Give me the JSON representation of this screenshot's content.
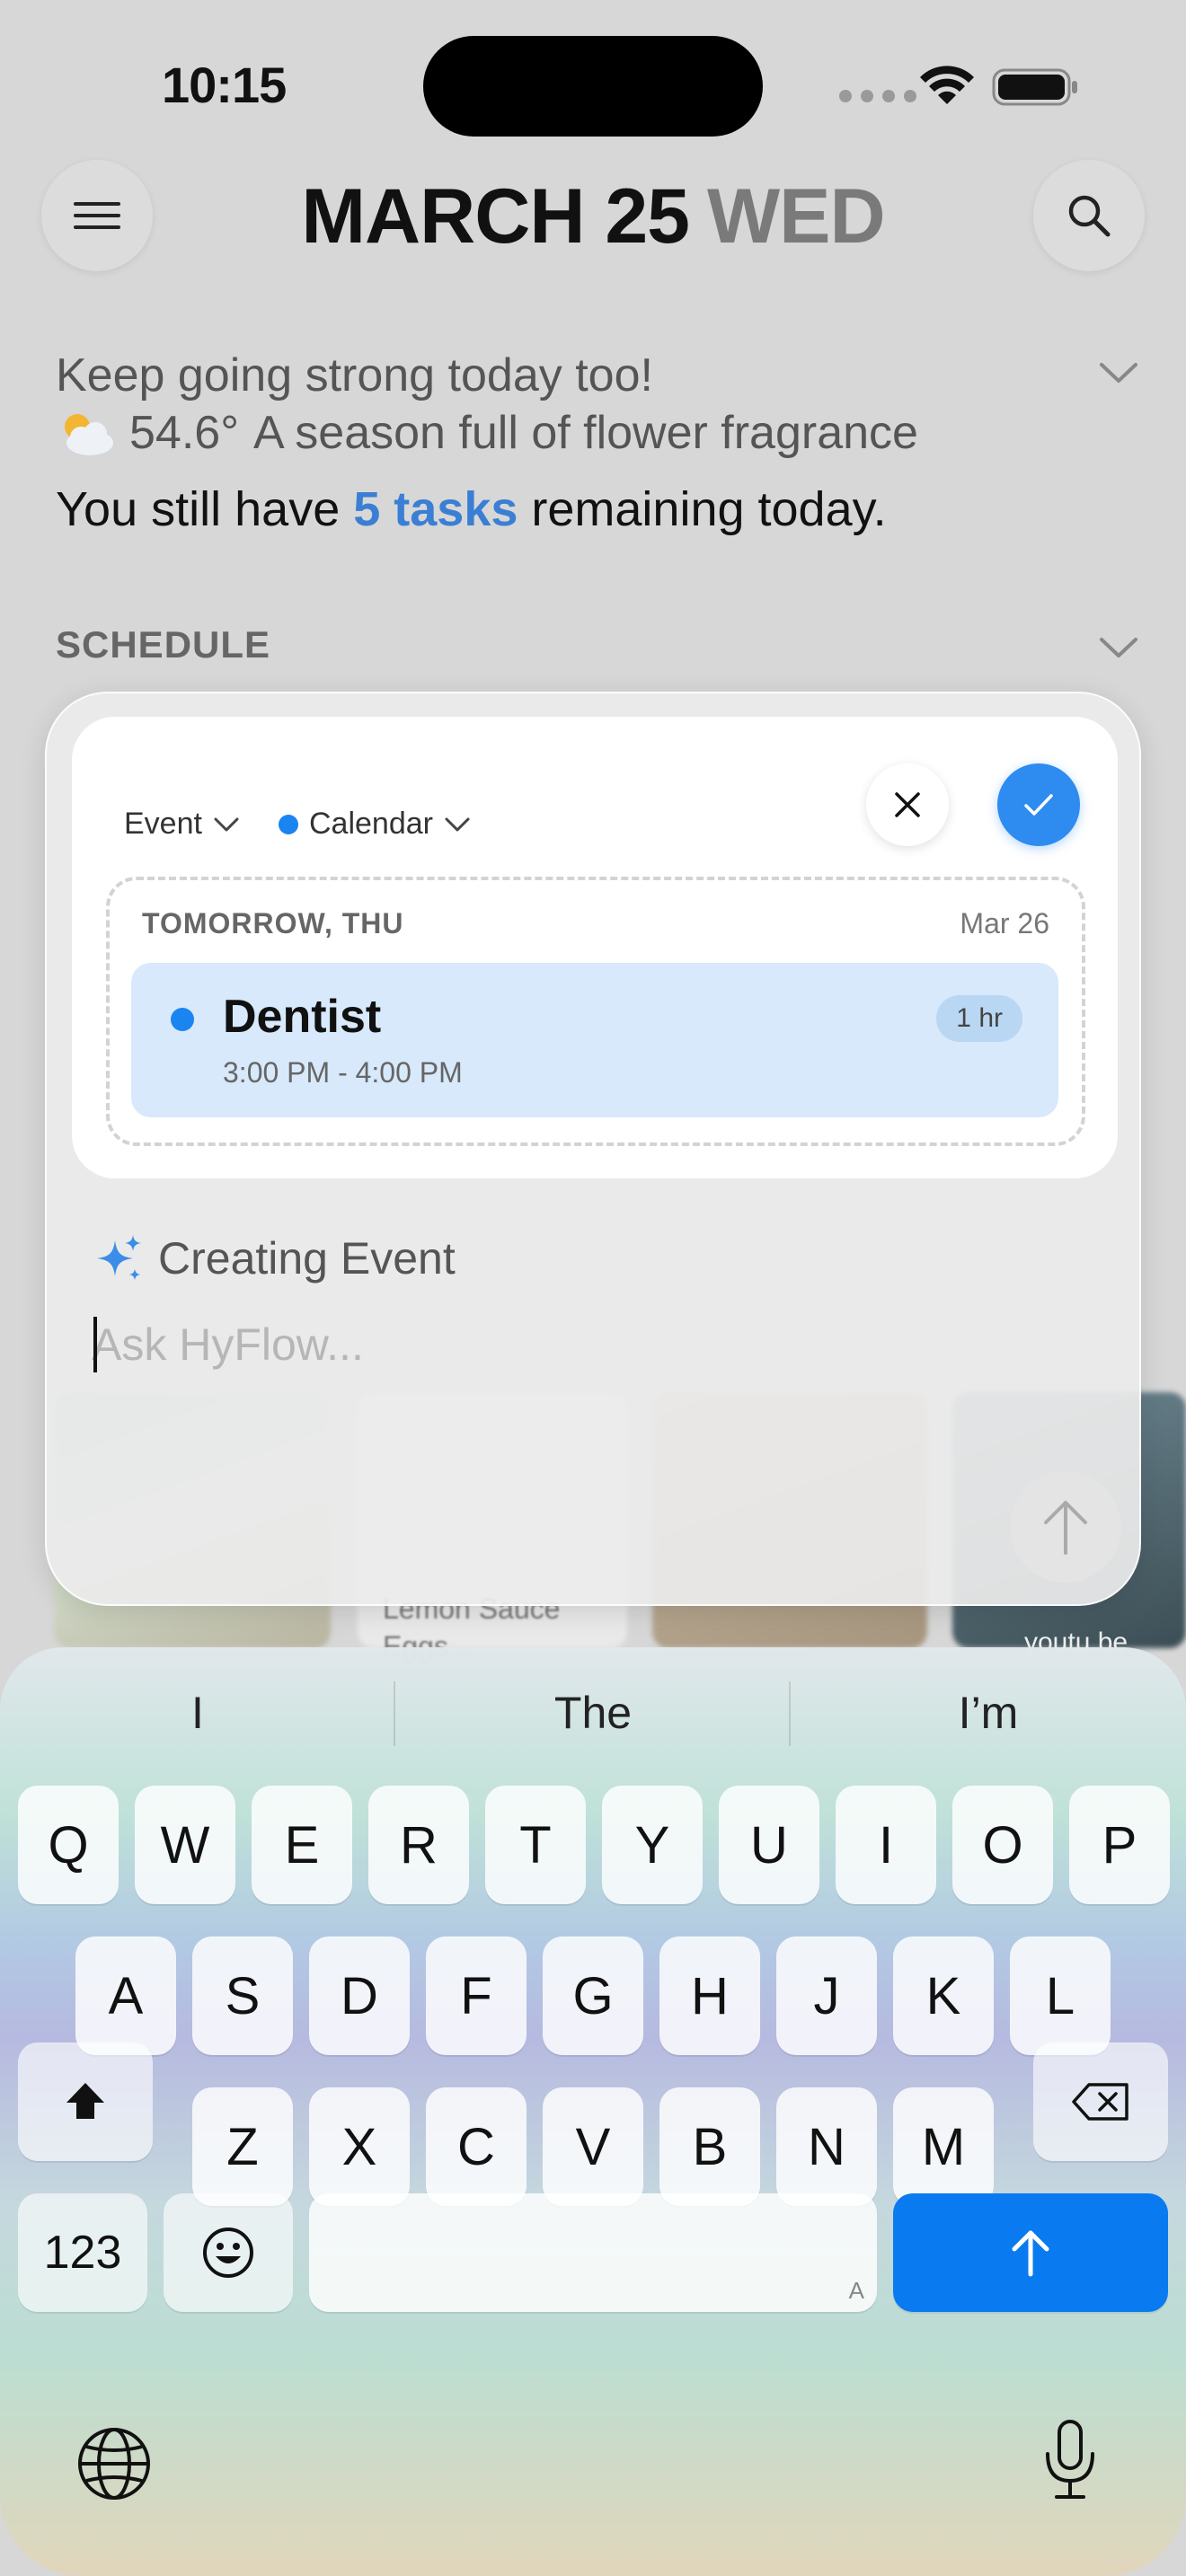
{
  "status": {
    "time": "10:15"
  },
  "header": {
    "date": "MARCH 25",
    "day": "WED"
  },
  "summary": {
    "greeting": "Keep going strong today too!",
    "weather_icon": "partly-cloudy-icon",
    "temperature": "54.6°",
    "weather_text": "A season full of flower fragrance",
    "tasks_prefix": "You still have ",
    "tasks_count": "5 tasks",
    "tasks_suffix": " remaining today."
  },
  "schedule": {
    "label": "SCHEDULE"
  },
  "background_cards": {
    "card_text": "Lemon Sauce\nEggs...",
    "card_text_right": "youtu.be"
  },
  "sheet": {
    "type_dropdown": "Event",
    "calendar_dropdown": "Calendar",
    "calendar_color": "#1a84f0",
    "preview": {
      "day_label": "TOMORROW, THU",
      "date_label": "Mar 26",
      "event_title": "Dentist",
      "event_time": "3:00 PM - 4:00 PM",
      "duration": "1 hr"
    },
    "status_text": "Creating Event",
    "input_placeholder": "Ask HyFlow...",
    "input_value": ""
  },
  "keyboard": {
    "suggestions": [
      "I",
      "The",
      "I’m"
    ],
    "row1": [
      "Q",
      "W",
      "E",
      "R",
      "T",
      "Y",
      "U",
      "I",
      "O",
      "P"
    ],
    "row2": [
      "A",
      "S",
      "D",
      "F",
      "G",
      "H",
      "J",
      "K",
      "L"
    ],
    "row3": [
      "Z",
      "X",
      "C",
      "V",
      "B",
      "N",
      "M"
    ],
    "numbers_key": "123",
    "space_hint": "A",
    "accent_color": "#0a7af0"
  }
}
